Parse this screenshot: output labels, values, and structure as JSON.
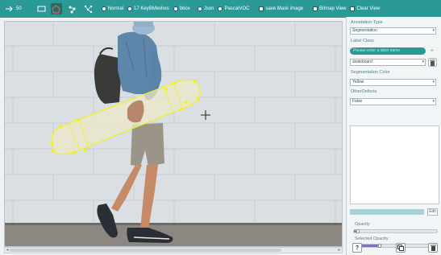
{
  "toolbar": {
    "zoom_value": "50",
    "radios": [
      "Normal",
      "17 KeyBMeshes",
      "bbox",
      "Json",
      "PascalVOC"
    ],
    "checks": [
      "save Mask image",
      "Bitmap View",
      "Clear View"
    ]
  },
  "panel": {
    "annotation_type_label": "Annotation Type",
    "annotation_type_value": "Segmentation",
    "label_class_label": "Label Class",
    "label_class_placeholder": "Please enter a label name",
    "label_class_value": "skateboard",
    "seg_color_label": "Segmentation Color",
    "seg_color_value": "Yellow",
    "other_defects_label": "OtherDefects",
    "other_defects_value": "False",
    "edit_label": "Edit",
    "opacity_label": "Opacity",
    "opacity_level": 0.03,
    "selected_opacity_label": "Selected Opacity",
    "selected_opacity_level": 0.3
  },
  "colors": {
    "toolbar_bg": "#2b9a97",
    "segmentation_outline": "#f2f21a",
    "slider_fill": "#7777b8"
  }
}
